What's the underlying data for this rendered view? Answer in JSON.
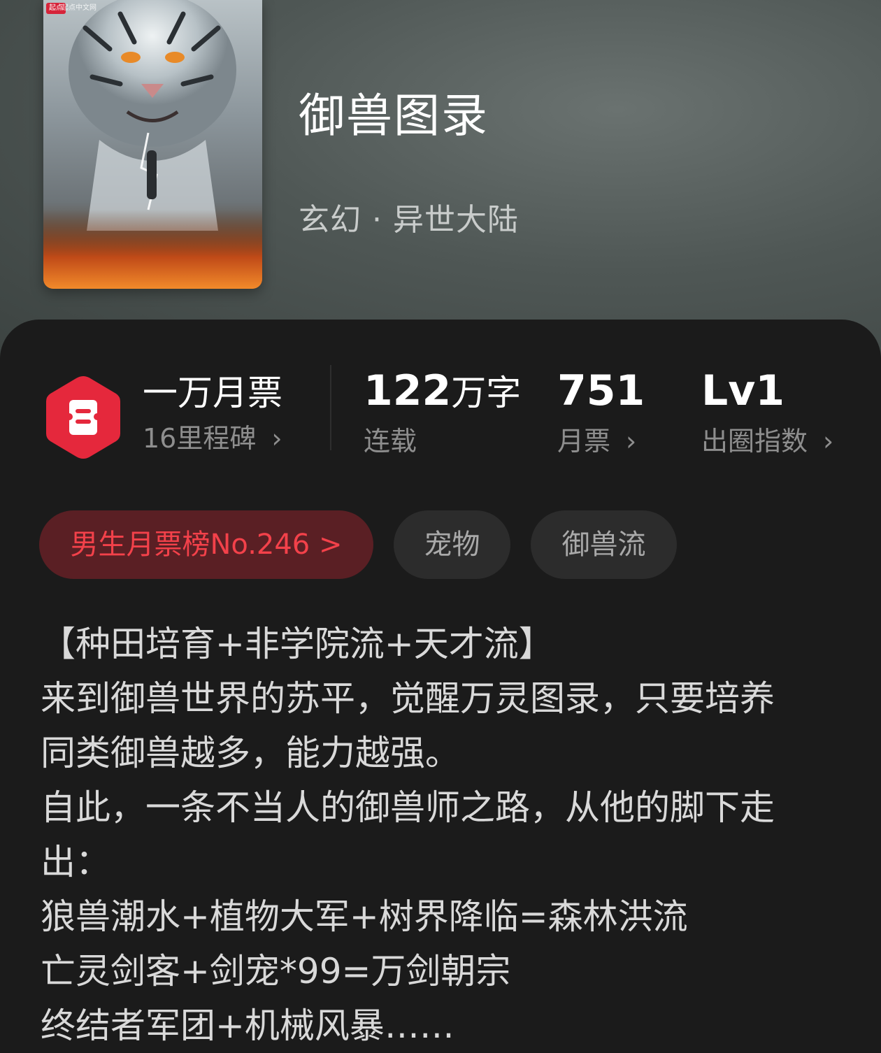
{
  "book": {
    "title": "御兽图录",
    "genre": "玄幻 · 异世大陆",
    "cover_logo": "起点",
    "cover_logo_text": "起点中文网"
  },
  "stats": {
    "badge": {
      "title": "一万月票",
      "subtitle": "16里程碑",
      "icon": "ticket-icon",
      "color": "#e5283c"
    },
    "words": {
      "number": "122",
      "unit": "万字",
      "label": "连载"
    },
    "votes": {
      "value": "751",
      "label": "月票"
    },
    "level": {
      "value": "Lv1",
      "label": "出圈指数"
    },
    "chevron": "›"
  },
  "tags": [
    {
      "label": "男生月票榜No.246 >"
    },
    {
      "label": "宠物"
    },
    {
      "label": "御兽流"
    }
  ],
  "description": [
    "【种田培育+非学院流+天才流】",
    "来到御兽世界的苏平，觉醒万灵图录，只要培养",
    "同类御兽越多，能力越强。",
    "自此，一条不当人的御兽师之路，从他的脚下走",
    "出：",
    "狼兽潮水+植物大军+树界降临=森林洪流",
    "亡灵剑客+剑宠*99=万剑朝宗",
    "终结者军团+机械风暴……"
  ],
  "colors": {
    "accent": "#f3414a",
    "rank_bg": "#5a1f24",
    "panel": "#1b1b1b"
  }
}
